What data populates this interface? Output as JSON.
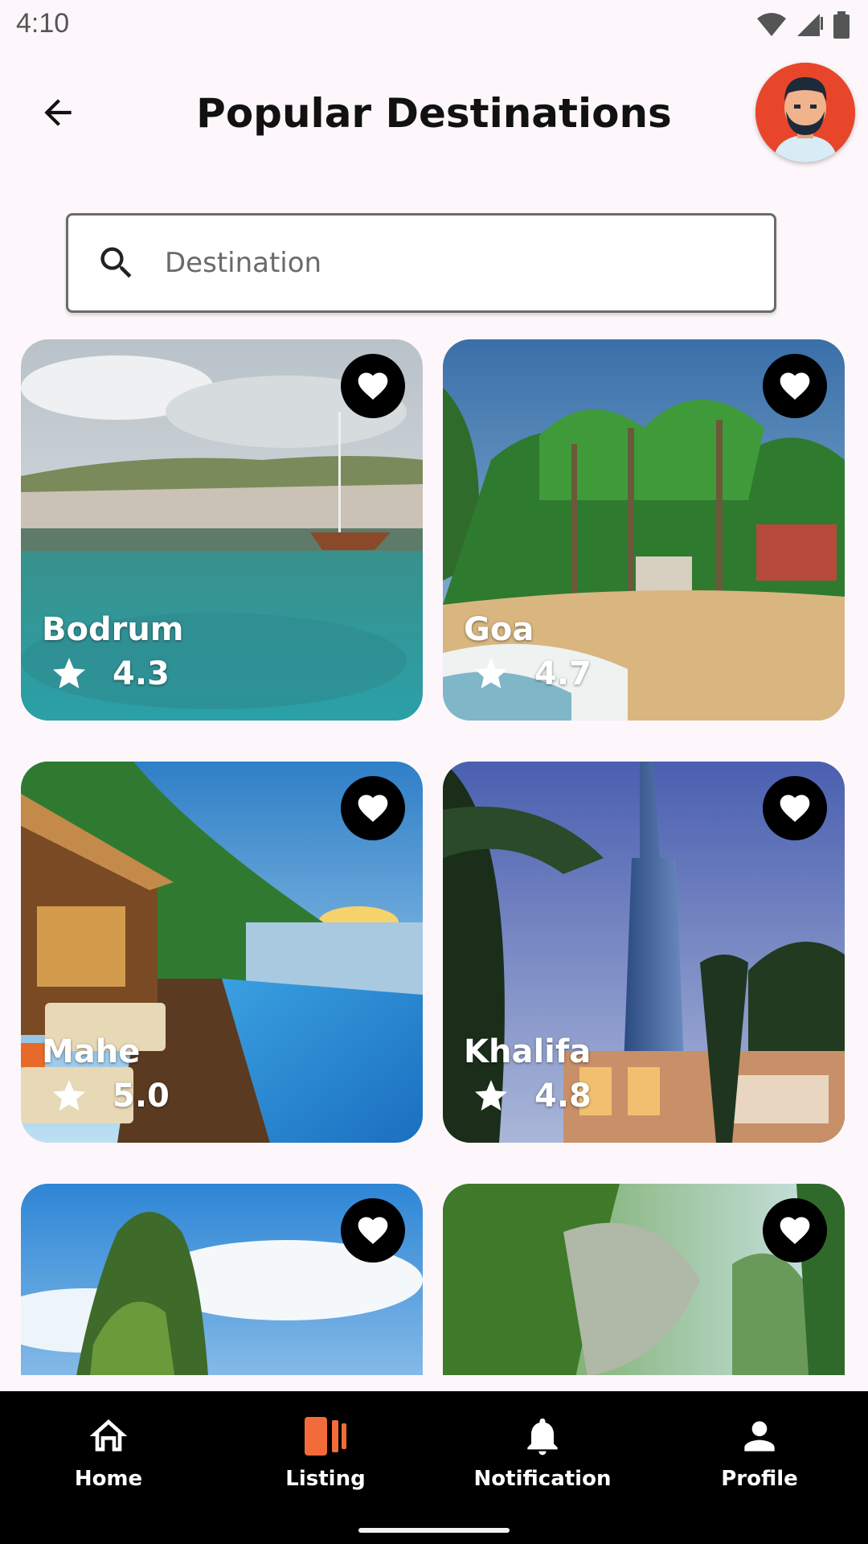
{
  "status_bar": {
    "time": "4:10"
  },
  "header": {
    "title": "Popular Destinations"
  },
  "search": {
    "placeholder": "Destination",
    "value": ""
  },
  "destinations": [
    {
      "name": "Bodrum",
      "rating": "4.3"
    },
    {
      "name": "Goa",
      "rating": "4.7"
    },
    {
      "name": "Mahe",
      "rating": "5.0"
    },
    {
      "name": "Khalifa",
      "rating": "4.8"
    },
    {
      "name": "",
      "rating": ""
    },
    {
      "name": "",
      "rating": ""
    }
  ],
  "bottom_nav": {
    "items": [
      {
        "label": "Home",
        "icon": "home-icon"
      },
      {
        "label": "Listing",
        "icon": "listing-icon",
        "active": true
      },
      {
        "label": "Notification",
        "icon": "bell-icon"
      },
      {
        "label": "Profile",
        "icon": "person-icon"
      }
    ]
  },
  "colors": {
    "accent": "#f26b3a",
    "nav_bg": "#000000",
    "page_bg": "#fdf7fb"
  }
}
